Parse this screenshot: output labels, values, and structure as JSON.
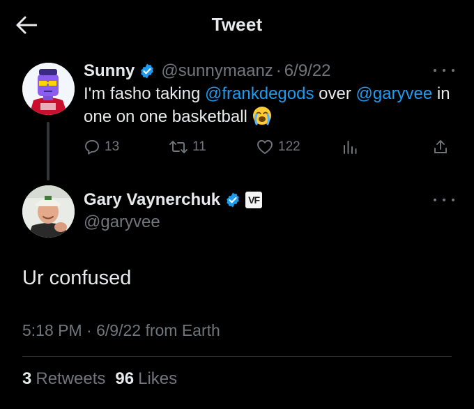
{
  "header": {
    "title": "Tweet",
    "back_icon": "arrow-left-icon"
  },
  "parent_tweet": {
    "author_name": "Sunny",
    "handle": "@sunnymaanz",
    "separator": "·",
    "date": "6/9/22",
    "text_1": "I'm fasho taking ",
    "mention_1": "@frankdegods",
    "text_2": " over ",
    "mention_2": "@garyvee",
    "text_3": " in one on one basketball",
    "emoji": "loudly-crying-face",
    "actions": {
      "replies": "13",
      "retweets": "11",
      "likes": "122"
    }
  },
  "main_tweet": {
    "author_name": "Gary Vaynerchuk",
    "handle": "@garyvee",
    "affiliate_badge": "VF",
    "text": "Ur confused",
    "time": "5:18 PM",
    "separator": "·",
    "date": "6/9/22",
    "source": "from Earth",
    "retweet_count": "3",
    "retweet_label": "Retweets",
    "like_count": "96",
    "like_label": "Likes"
  },
  "colors": {
    "background": "#000000",
    "text": "#e7e9ea",
    "muted": "#71767b",
    "accent": "#1d9bf0",
    "divider": "#2f3336"
  }
}
